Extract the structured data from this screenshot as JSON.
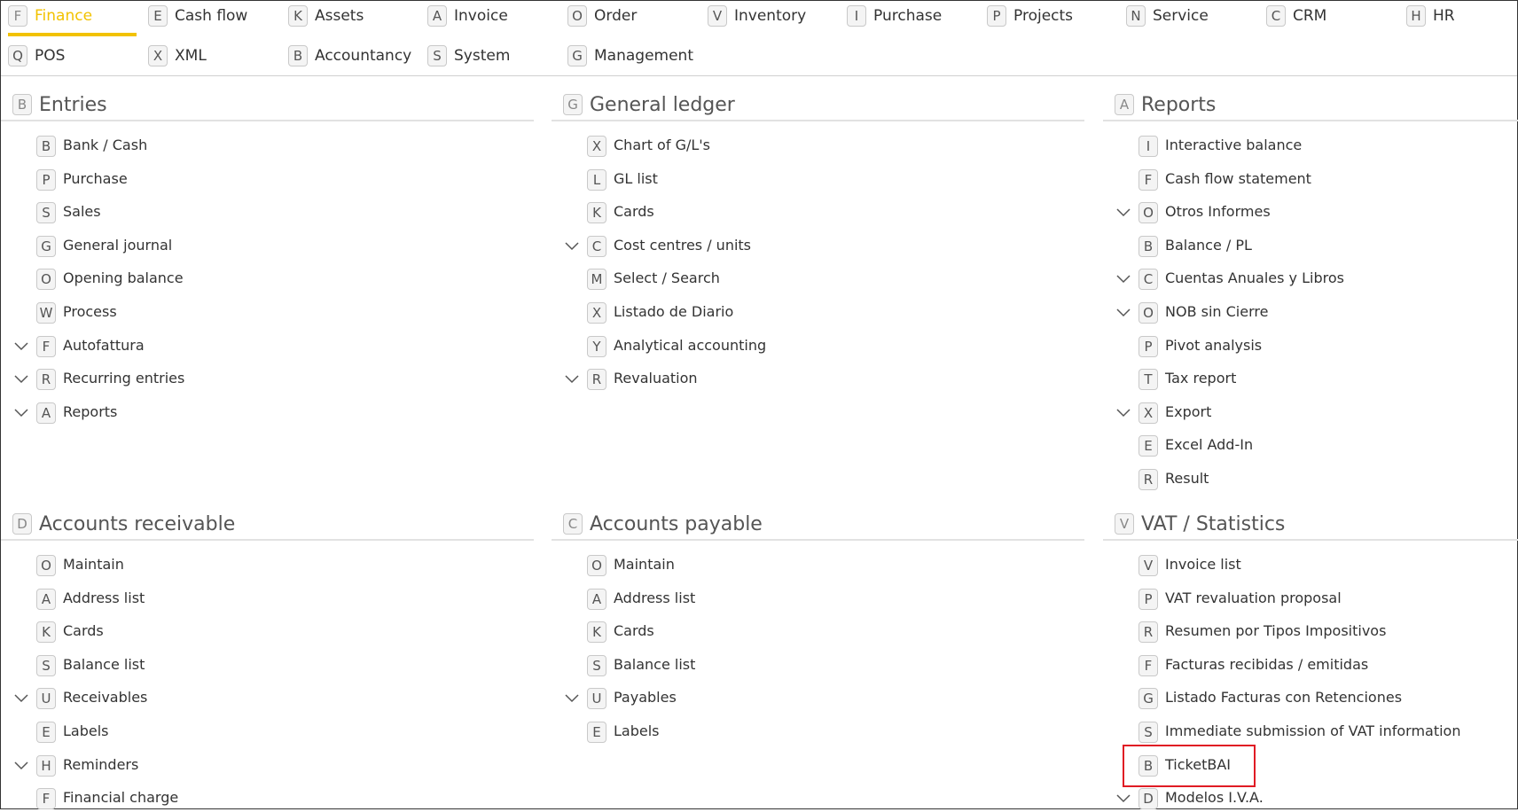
{
  "nav": {
    "items": [
      {
        "key": "F",
        "label": "Finance",
        "active": true
      },
      {
        "key": "E",
        "label": "Cash flow"
      },
      {
        "key": "K",
        "label": "Assets"
      },
      {
        "key": "A",
        "label": "Invoice"
      },
      {
        "key": "O",
        "label": "Order"
      },
      {
        "key": "V",
        "label": "Inventory"
      },
      {
        "key": "I",
        "label": "Purchase"
      },
      {
        "key": "P",
        "label": "Projects"
      },
      {
        "key": "N",
        "label": "Service"
      },
      {
        "key": "C",
        "label": "CRM"
      },
      {
        "key": "H",
        "label": "HR"
      },
      {
        "key": "Q",
        "label": "POS"
      },
      {
        "key": "X",
        "label": "XML"
      },
      {
        "key": "B",
        "label": "Accountancy"
      },
      {
        "key": "S",
        "label": "System"
      },
      {
        "key": "G",
        "label": "Management"
      }
    ]
  },
  "sections": [
    {
      "key": "B",
      "title": "Entries",
      "items": [
        {
          "key": "B",
          "label": "Bank / Cash"
        },
        {
          "key": "P",
          "label": "Purchase"
        },
        {
          "key": "S",
          "label": "Sales"
        },
        {
          "key": "G",
          "label": "General journal"
        },
        {
          "key": "O",
          "label": "Opening balance"
        },
        {
          "key": "W",
          "label": "Process"
        },
        {
          "key": "F",
          "label": "Autofattura",
          "expandable": true
        },
        {
          "key": "R",
          "label": "Recurring entries",
          "expandable": true
        },
        {
          "key": "A",
          "label": "Reports",
          "expandable": true
        }
      ]
    },
    {
      "key": "G",
      "title": "General ledger",
      "items": [
        {
          "key": "X",
          "label": "Chart of G/L's"
        },
        {
          "key": "L",
          "label": "GL list"
        },
        {
          "key": "K",
          "label": "Cards"
        },
        {
          "key": "C",
          "label": "Cost centres / units",
          "expandable": true
        },
        {
          "key": "M",
          "label": "Select / Search"
        },
        {
          "key": "X",
          "label": "Listado de Diario"
        },
        {
          "key": "Y",
          "label": "Analytical accounting"
        },
        {
          "key": "R",
          "label": "Revaluation",
          "expandable": true
        }
      ]
    },
    {
      "key": "A",
      "title": "Reports",
      "items": [
        {
          "key": "I",
          "label": "Interactive balance"
        },
        {
          "key": "F",
          "label": "Cash flow statement"
        },
        {
          "key": "O",
          "label": "Otros Informes",
          "expandable": true
        },
        {
          "key": "B",
          "label": "Balance / PL"
        },
        {
          "key": "C",
          "label": "Cuentas Anuales y Libros",
          "expandable": true
        },
        {
          "key": "O",
          "label": "NOB sin Cierre",
          "expandable": true
        },
        {
          "key": "P",
          "label": "Pivot analysis"
        },
        {
          "key": "T",
          "label": "Tax report"
        },
        {
          "key": "X",
          "label": "Export",
          "expandable": true
        },
        {
          "key": "E",
          "label": "Excel Add-In"
        },
        {
          "key": "R",
          "label": "Result"
        }
      ]
    },
    {
      "key": "D",
      "title": "Accounts receivable",
      "items": [
        {
          "key": "O",
          "label": "Maintain"
        },
        {
          "key": "A",
          "label": "Address list"
        },
        {
          "key": "K",
          "label": "Cards"
        },
        {
          "key": "S",
          "label": "Balance list"
        },
        {
          "key": "U",
          "label": "Receivables",
          "expandable": true
        },
        {
          "key": "E",
          "label": "Labels"
        },
        {
          "key": "H",
          "label": "Reminders",
          "expandable": true
        },
        {
          "key": "F",
          "label": "Financial charge"
        }
      ]
    },
    {
      "key": "C",
      "title": "Accounts payable",
      "items": [
        {
          "key": "O",
          "label": "Maintain"
        },
        {
          "key": "A",
          "label": "Address list"
        },
        {
          "key": "K",
          "label": "Cards"
        },
        {
          "key": "S",
          "label": "Balance list"
        },
        {
          "key": "U",
          "label": "Payables",
          "expandable": true
        },
        {
          "key": "E",
          "label": "Labels"
        }
      ]
    },
    {
      "key": "V",
      "title": "VAT / Statistics",
      "items": [
        {
          "key": "V",
          "label": "Invoice list"
        },
        {
          "key": "P",
          "label": "VAT revaluation proposal"
        },
        {
          "key": "R",
          "label": "Resumen por Tipos Impositivos"
        },
        {
          "key": "F",
          "label": "Facturas recibidas / emitidas"
        },
        {
          "key": "G",
          "label": "Listado Facturas con Retenciones"
        },
        {
          "key": "S",
          "label": "Immediate submission of VAT information"
        },
        {
          "key": "B",
          "label": "TicketBAI",
          "highlighted": true
        },
        {
          "key": "D",
          "label": "Modelos I.V.A.",
          "expandable": true
        }
      ]
    }
  ],
  "colors": {
    "active": "#f2c200",
    "highlight": "#e01b24"
  }
}
